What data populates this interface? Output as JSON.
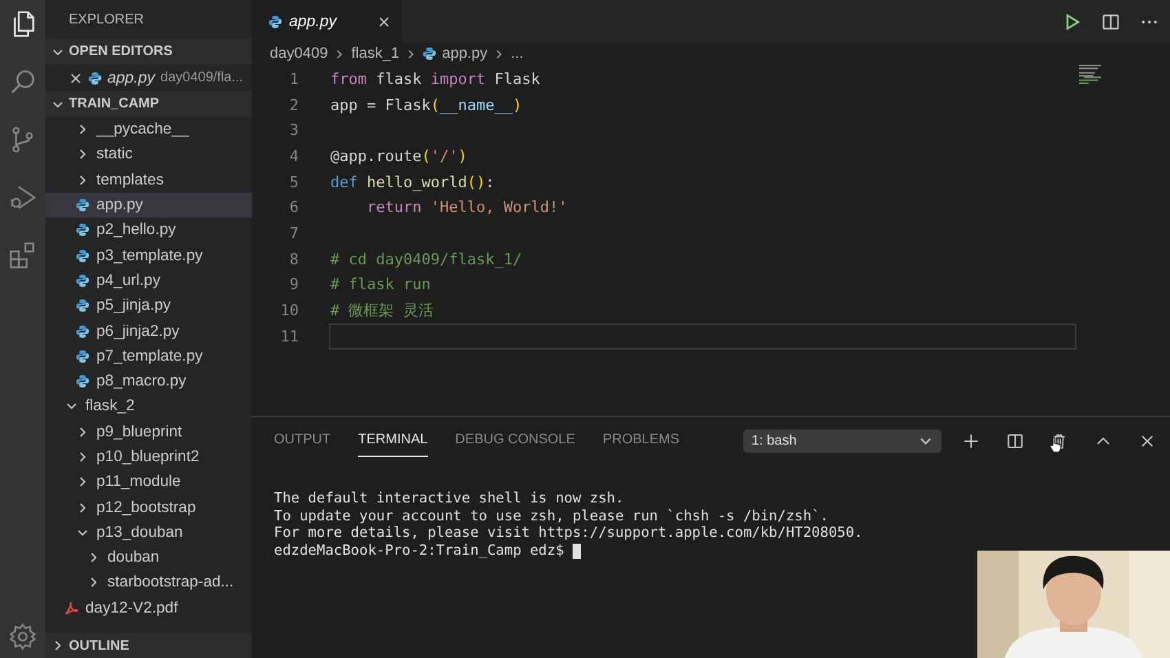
{
  "sidebar": {
    "title": "EXPLORER",
    "sections": [
      {
        "label": "OPEN EDITORS",
        "expanded": true
      },
      {
        "label": "TRAIN_CAMP",
        "expanded": true
      },
      {
        "label": "OUTLINE",
        "expanded": false
      }
    ],
    "open_editors": [
      {
        "name": "app.py",
        "path": "day0409/fla..."
      }
    ],
    "tree": [
      {
        "children": [
          {
            "label": "__pycache__",
            "kind": "folder",
            "expanded": false,
            "selected": false
          },
          {
            "label": "static",
            "kind": "folder",
            "expanded": false,
            "selected": false
          },
          {
            "label": "templates",
            "kind": "folder",
            "expanded": false,
            "selected": false
          },
          {
            "label": "app.py",
            "kind": "python",
            "selected": true
          },
          {
            "label": "p2_hello.py",
            "kind": "python",
            "selected": false
          },
          {
            "label": "p3_template.py",
            "kind": "python",
            "selected": false
          },
          {
            "label": "p4_url.py",
            "kind": "python",
            "selected": false
          },
          {
            "label": "p5_jinja.py",
            "kind": "python",
            "selected": false
          },
          {
            "label": "p6_jinja2.py",
            "kind": "python",
            "selected": false
          },
          {
            "label": "p7_template.py",
            "kind": "python",
            "selected": false
          },
          {
            "label": "p8_macro.py",
            "kind": "python",
            "selected": false
          }
        ]
      },
      {
        "label": "flask_2",
        "kind": "folder",
        "expanded": true,
        "selected": false,
        "children": [
          {
            "label": "p9_blueprint",
            "kind": "folder",
            "expanded": false,
            "selected": false
          },
          {
            "label": "p10_blueprint2",
            "kind": "folder",
            "expanded": false,
            "selected": false
          },
          {
            "label": "p11_module",
            "kind": "folder",
            "expanded": false,
            "selected": false
          },
          {
            "label": "p12_bootstrap",
            "kind": "folder",
            "expanded": false,
            "selected": false
          },
          {
            "label": "p13_douban",
            "kind": "folder",
            "expanded": true,
            "selected": false,
            "children": [
              {
                "label": "douban",
                "kind": "folder",
                "expanded": false,
                "selected": false
              },
              {
                "label": "starbootstrap-ad...",
                "kind": "folder",
                "expanded": false,
                "selected": false
              }
            ]
          }
        ]
      },
      {
        "label": "day12-V2.pdf",
        "kind": "pdf",
        "selected": false
      }
    ]
  },
  "editor": {
    "tab": {
      "label": "app.py"
    },
    "breadcrumb": [
      "day0409",
      "flask_1",
      "app.py",
      "..."
    ],
    "lines": [
      {
        "number": "1",
        "current": false,
        "tokens": [
          {
            "text": "from",
            "kind": "keyword"
          },
          {
            "text": " flask ",
            "kind": "plain"
          },
          {
            "text": "import",
            "kind": "keyword"
          },
          {
            "text": " Flask",
            "kind": "plain"
          }
        ]
      },
      {
        "number": "2",
        "current": false,
        "tokens": [
          {
            "text": "app = Flask",
            "kind": "plain"
          },
          {
            "text": "(",
            "kind": "paren"
          },
          {
            "text": "__name__",
            "kind": "var"
          },
          {
            "text": ")",
            "kind": "paren"
          }
        ]
      },
      {
        "number": "3",
        "current": false
      },
      {
        "number": "4",
        "current": false,
        "tokens": [
          {
            "text": "@app.route",
            "kind": "plain"
          },
          {
            "text": "(",
            "kind": "paren"
          },
          {
            "text": "'/'",
            "kind": "string"
          },
          {
            "text": ")",
            "kind": "paren"
          }
        ]
      },
      {
        "number": "5",
        "current": false,
        "tokens": [
          {
            "text": "def",
            "kind": "def"
          },
          {
            "text": " hello_world",
            "kind": "func"
          },
          {
            "text": "()",
            "kind": "paren"
          },
          {
            "text": ":",
            "kind": "plain"
          }
        ]
      },
      {
        "number": "6",
        "current": false,
        "tokens": [
          {
            "text": "    return",
            "kind": "keyword"
          },
          {
            "text": " 'Hello, World!'",
            "kind": "string"
          }
        ]
      },
      {
        "number": "7",
        "current": false
      },
      {
        "number": "8",
        "current": false,
        "tokens": [
          {
            "text": "# cd day0409/flask_1/",
            "kind": "comment"
          }
        ]
      },
      {
        "number": "9",
        "current": false,
        "tokens": [
          {
            "text": "# flask run",
            "kind": "comment"
          }
        ]
      },
      {
        "number": "10",
        "current": false,
        "tokens": [
          {
            "text": "# 微框架 灵活",
            "kind": "comment"
          }
        ]
      },
      {
        "number": "11",
        "current": true
      }
    ]
  },
  "panel": {
    "tabs": [
      {
        "label": "OUTPUT",
        "selected": false
      },
      {
        "label": "TERMINAL",
        "selected": true
      },
      {
        "label": "DEBUG CONSOLE",
        "selected": false
      },
      {
        "label": "PROBLEMS",
        "selected": false
      }
    ],
    "terminal_select": "1: bash",
    "terminal": [
      "The default interactive shell is now zsh.",
      "To update your account to use zsh, please run `chsh -s /bin/zsh`.",
      "For more details, please visit https://support.apple.com/kb/HT208050.",
      "edzdeMacBook-Pro-2:Train_Camp edz$"
    ]
  }
}
